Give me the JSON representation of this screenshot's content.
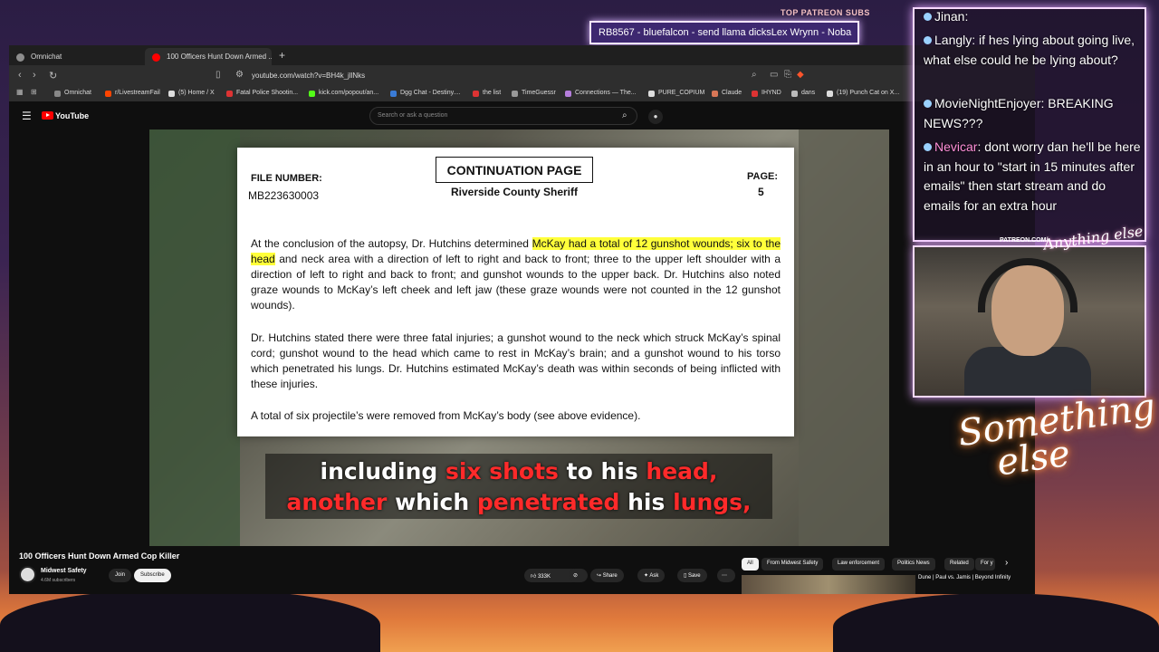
{
  "overlay": {
    "patreon_label": "TOP PATREON SUBS",
    "ticker_text": "RB8567 - bluefalcon - send llama dicksLex Wrynn - Noba",
    "patreon_cam_label": "PATREON.COM/",
    "signature_small": "Anything else",
    "signature_big": "Something else"
  },
  "browser": {
    "tabs": [
      {
        "label": "Omnichat",
        "color": "#8d8d8d"
      },
      {
        "label": "100 Officers Hunt Down Armed ...",
        "color": "#ff0000"
      }
    ],
    "new_tab": "+",
    "url": "youtube.com/watch?v=BH4k_jllNks",
    "bookmarks": [
      {
        "label": "Omnichat",
        "color": "#888888"
      },
      {
        "label": "r/LivestreamFail",
        "color": "#ff4500"
      },
      {
        "label": "(5) Home / X",
        "color": "#dddddd"
      },
      {
        "label": "Fatal Police Shootin...",
        "color": "#d33"
      },
      {
        "label": "kick.com/popout/an...",
        "color": "#53fc18"
      },
      {
        "label": "Dgg Chat - Destiny....",
        "color": "#3a7bd5"
      },
      {
        "label": "the list",
        "color": "#d33"
      },
      {
        "label": "TimeGuessr",
        "color": "#999"
      },
      {
        "label": "Connections — The...",
        "color": "#b57edc"
      },
      {
        "label": "PURE_COPIUM",
        "color": "#dddddd"
      },
      {
        "label": "Claude",
        "color": "#d97757"
      },
      {
        "label": "IHYND",
        "color": "#d33"
      },
      {
        "label": "dans",
        "color": "#bbb"
      },
      {
        "label": "(19) Punch Cat on X...",
        "color": "#dddddd"
      }
    ]
  },
  "youtube": {
    "logo": "YouTube",
    "search_placeholder": "Search or ask a question",
    "video_title": "100 Officers Hunt Down Armed Cop Killer",
    "channel": "Midwest Safety",
    "subscribers": "4.6M subscribers",
    "join": "Join",
    "subscribe": "Subscribe",
    "likes": "333K",
    "share": "Share",
    "ask": "Ask",
    "save": "Save",
    "more": "⋯",
    "chips": [
      "All",
      "From Midwest Safety",
      "Law enforcement",
      "Politics News",
      "Related",
      "For y"
    ],
    "rec_title": "Dune | Paul vs. Jamis | Beyond Infinity"
  },
  "document": {
    "file_number_label": "FILE NUMBER:",
    "file_number": "MB223630003",
    "heading": "CONTINUATION PAGE",
    "sheriff": "Riverside County Sheriff",
    "page_label": "PAGE:",
    "page_number": "5",
    "p1_a": "At the conclusion of the autopsy, Dr. Hutchins determined ",
    "p1_hl": "McKay had a total of 12 gunshot wounds; six to the head",
    "p1_b": " and neck area with a direction of left to right and back to front; three to the upper left shoulder with a direction of left to right and back to front; and gunshot wounds to the upper back.  Dr. Hutchins also noted graze wounds to McKay’s left cheek and left jaw (these graze wounds were not counted in the 12 gunshot wounds).",
    "p2": "Dr. Hutchins stated there were three fatal injuries; a gunshot wound to the neck which struck McKay’s spinal cord; gunshot wound to the head which came to rest in McKay’s brain; and a gunshot wound to his torso which penetrated his lungs.  Dr. Hutchins estimated McKay’s death was within seconds of being inflicted with these injuries.",
    "p3": "A total of six projectile’s were removed from McKay’s body (see above evidence)."
  },
  "caption": {
    "line1": [
      {
        "t": "including ",
        "c": "w"
      },
      {
        "t": "six shots ",
        "c": "r"
      },
      {
        "t": "to his ",
        "c": "w"
      },
      {
        "t": "head,",
        "c": "r"
      }
    ],
    "line2": [
      {
        "t": "another ",
        "c": "r"
      },
      {
        "t": "which ",
        "c": "w"
      },
      {
        "t": "penetrated ",
        "c": "r"
      },
      {
        "t": "his ",
        "c": "w"
      },
      {
        "t": "lungs,",
        "c": "r"
      }
    ]
  },
  "chat": [
    {
      "user": "Jinan",
      "text": ": "
    },
    {
      "user": "Langly",
      "text": ": if hes lying about going live, what else could he be lying about?"
    },
    {
      "user": "MovieNightEnjoyer",
      "text": ": BREAKING NEWS???"
    },
    {
      "user": "Nevicar",
      "text": ": dont worry dan he'll be here in an hour to \"start in 15 minutes after emails\" then start stream and do emails for an extra hour"
    }
  ]
}
